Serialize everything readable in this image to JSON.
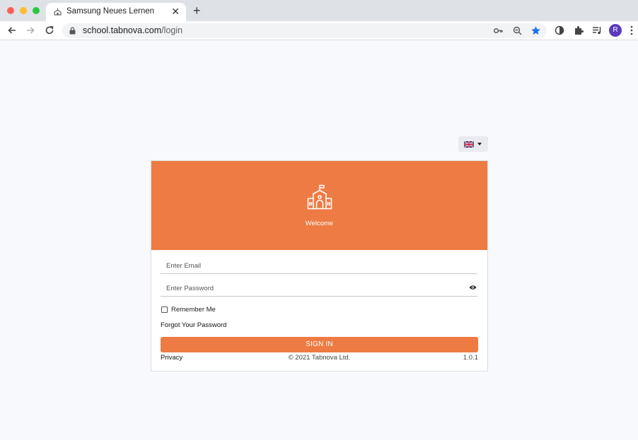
{
  "browser": {
    "tab": {
      "title": "Samsung Neues Lernen",
      "close": "✕"
    },
    "new_tab": "+",
    "url": {
      "host": "school.tabnova.com",
      "path": "/login"
    },
    "profile_initial": "R",
    "icons": [
      "back-arrow-icon",
      "forward-arrow-icon",
      "reload-icon",
      "lock-icon",
      "key-icon",
      "zoom-icon",
      "star-icon",
      "extension-circle-icon",
      "puzzle-icon",
      "media-queue-icon",
      "kebab-menu-icon"
    ],
    "accent": "#1a73e8"
  },
  "language": {
    "selected_flag": "uk-flag-icon"
  },
  "login": {
    "header_color": "#ee7b43",
    "welcome": "Welcome",
    "email_placeholder": "Enter Email",
    "password_placeholder": "Enter Password",
    "remember_label": "Remember Me",
    "forgot_label": "Forgot Your Password",
    "signin_label": "SIGN IN",
    "privacy_label": "Privacy",
    "copyright": "© 2021 Tabnova Ltd.",
    "version": "1.0.1"
  }
}
